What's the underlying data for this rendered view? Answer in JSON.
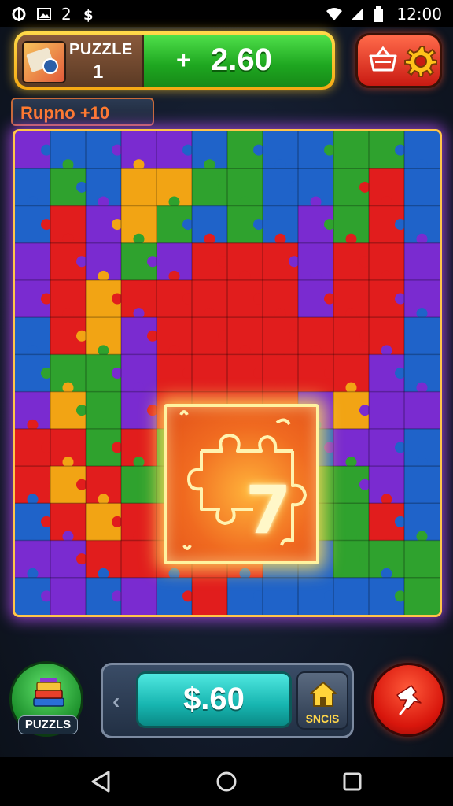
{
  "status_bar": {
    "digit": "2",
    "time": "12:00",
    "icons": [
      "sync-icon",
      "image-icon",
      "dollar-icon",
      "wifi-icon",
      "signal-icon",
      "battery-icon"
    ]
  },
  "hud": {
    "puzzle_label": "PUZZLE",
    "puzzle_number": "1",
    "score_prefix": "+",
    "score_value": "2.60"
  },
  "level_badge": {
    "text": "Rupno +10"
  },
  "board": {
    "center_mark": "7",
    "colors": [
      "#1f63c9",
      "#2fa22e",
      "#e11d1d",
      "#7a2bd0",
      "#f2a414",
      "#ffffff"
    ]
  },
  "bottom": {
    "collection_label": "PUZZLS",
    "price_value": "$.60",
    "shop_label": "SNCIS"
  },
  "colors": {
    "accent_gold": "#ffc54a",
    "hud_green": "#1ea620",
    "action_red": "#d8160c",
    "price_teal": "#17b5b0"
  }
}
